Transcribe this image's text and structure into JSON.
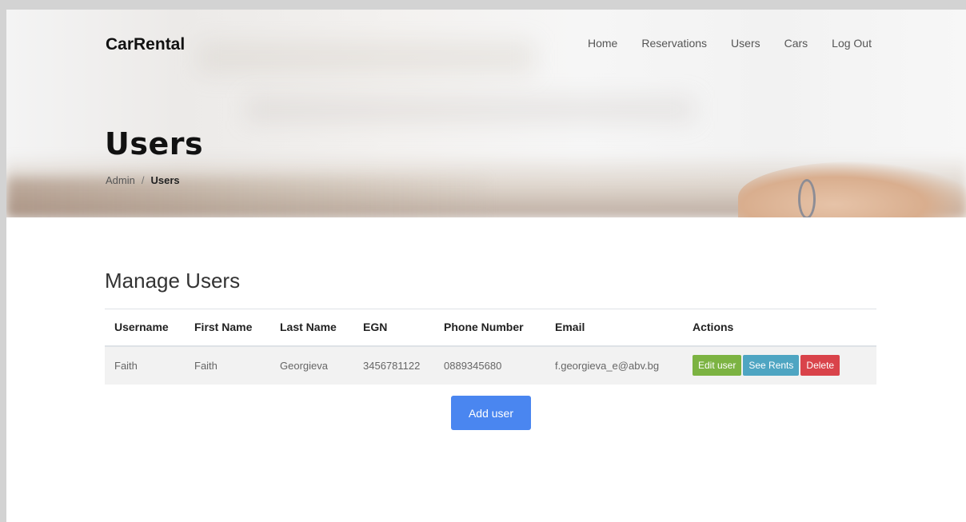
{
  "header": {
    "brand": "CarRental",
    "nav": [
      {
        "label": "Home"
      },
      {
        "label": "Reservations"
      },
      {
        "label": "Users"
      },
      {
        "label": "Cars"
      },
      {
        "label": "Log Out"
      }
    ]
  },
  "hero": {
    "title": "Users",
    "breadcrumb": {
      "parent": "Admin",
      "separator": "/",
      "current": "Users"
    }
  },
  "main": {
    "section_title": "Manage Users",
    "table": {
      "columns": [
        "Username",
        "First Name",
        "Last Name",
        "EGN",
        "Phone Number",
        "Email",
        "Actions"
      ],
      "rows": [
        {
          "username": "Faith",
          "first_name": "Faith",
          "last_name": "Georgieva",
          "egn": "3456781122",
          "phone": "0889345680",
          "email": "f.georgieva_e@abv.bg",
          "actions": {
            "edit": "Edit user",
            "rents": "See Rents",
            "delete": "Delete"
          }
        }
      ]
    },
    "add_button": "Add user"
  },
  "colors": {
    "edit": "#7cb342",
    "rents": "#4ea5c2",
    "delete": "#d9434a",
    "primary": "#4a86f0"
  }
}
